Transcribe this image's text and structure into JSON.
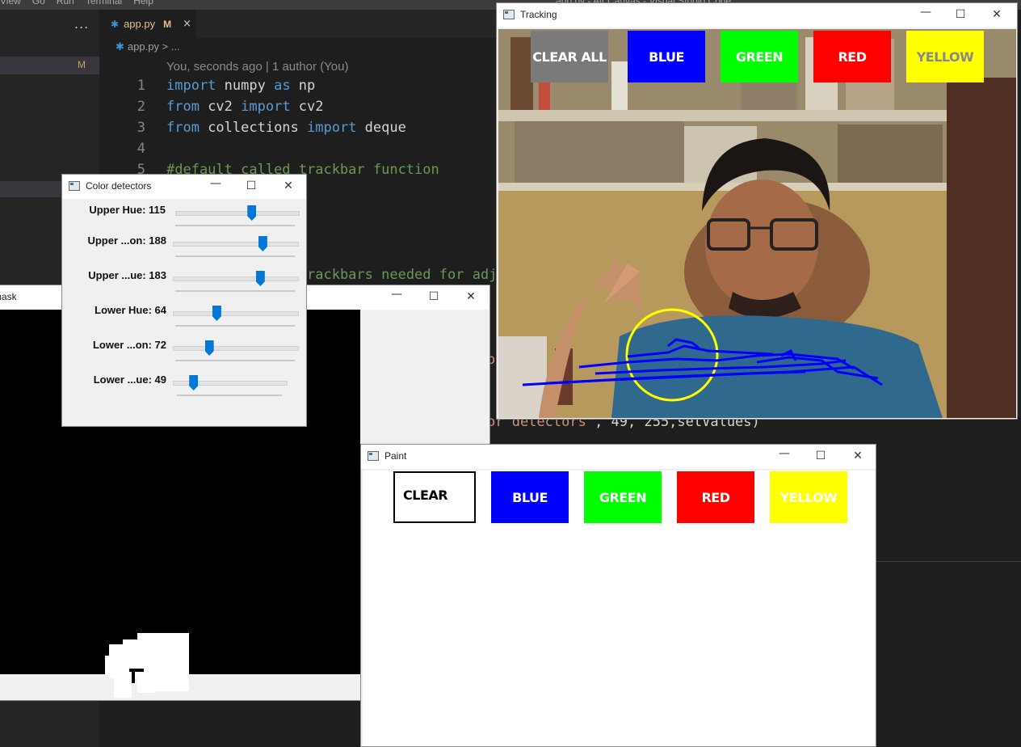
{
  "vscode": {
    "menu": [
      "View",
      "Go",
      "Run",
      "Terminal",
      "Help"
    ],
    "title": "app.py - Air Canvas - Visual Studio Code",
    "sidebar_more": "...",
    "sidebar_modified": "M",
    "tab": {
      "filename": "app.py",
      "modified": "M",
      "close": "×"
    },
    "breadcrumb": "app.py > ...",
    "blame": "You, seconds ago | 1 author (You)",
    "code": [
      {
        "num": "1",
        "a": "import",
        "b": " numpy ",
        "c": "as",
        "d": " np"
      },
      {
        "num": "2",
        "a": "from",
        "b": " cv2 ",
        "c": "import",
        "d": " cv2"
      },
      {
        "num": "3",
        "a": "from",
        "b": " collections ",
        "c": "import",
        "d": " deque"
      },
      {
        "num": "4"
      },
      {
        "num": "5",
        "comment": "#default called trackbar function"
      }
    ],
    "frag_trackbars": "rackbars needed for adj",
    "frag_o": "o",
    "frag_detectors_str": "or detectors\"",
    "frag_detectors_rest": ", 49, 255,setValues)"
  },
  "mask_window": {
    "title": "mask"
  },
  "color_detectors": {
    "title": "Color detectors",
    "trackbars": [
      {
        "label": "Upper Hue: 115",
        "fraction": 0.62
      },
      {
        "label": "Upper ...on: 188",
        "fraction": 0.72
      },
      {
        "label": "Upper ...ue: 183",
        "fraction": 0.7
      },
      {
        "label": "Lower Hue: 64",
        "fraction": 0.35
      },
      {
        "label": "Lower ...on: 72",
        "fraction": 0.29
      },
      {
        "label": "Lower ...ue: 49",
        "fraction": 0.18
      }
    ]
  },
  "tracking": {
    "title": "Tracking",
    "buttons": [
      {
        "label": "CLEAR ALL",
        "bg": "#7a7a7a",
        "fg": "#ffffff"
      },
      {
        "label": "BLUE",
        "bg": "#0000ff",
        "fg": "#ffffff"
      },
      {
        "label": "GREEN",
        "bg": "#00ff00",
        "fg": "#ffffff"
      },
      {
        "label": "RED",
        "bg": "#ff0000",
        "fg": "#ffffff"
      },
      {
        "label": "YELLOW",
        "bg": "#ffff00",
        "fg": "#888888"
      }
    ],
    "pointer_circle_color": "#ffff00",
    "stroke_color": "#0000ff"
  },
  "paint": {
    "title": "Paint",
    "buttons": [
      {
        "label": "CLEAR",
        "bg": "#ffffff",
        "fg": "#000000"
      },
      {
        "label": "BLUE",
        "bg": "#0000ff",
        "fg": "#ffffff"
      },
      {
        "label": "GREEN",
        "bg": "#00ff00",
        "fg": "#ffffff"
      },
      {
        "label": "RED",
        "bg": "#ff0000",
        "fg": "#ffffff"
      },
      {
        "label": "YELLOW",
        "bg": "#ffff00",
        "fg": "#ffffff"
      }
    ]
  },
  "window_controls": {
    "minimize": "—",
    "maximize": "☐",
    "close": "✕"
  }
}
